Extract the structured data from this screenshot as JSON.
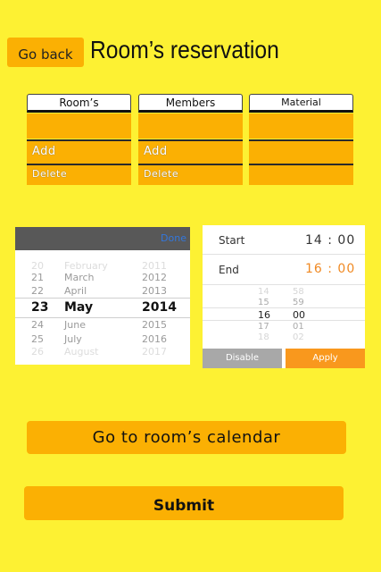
{
  "header": {
    "go_back_label": "Go back",
    "title": "Room’s reservation"
  },
  "columns": [
    {
      "header": "Room’s",
      "items": [
        "Add",
        "Delete"
      ]
    },
    {
      "header": "Members",
      "items": [
        "Add",
        "Delete"
      ]
    },
    {
      "header": "Material",
      "items": []
    }
  ],
  "date_picker": {
    "done_label": "Done",
    "rows": [
      {
        "day": "20",
        "month": "February",
        "year": "2011"
      },
      {
        "day": "21",
        "month": "March",
        "year": "2012"
      },
      {
        "day": "22",
        "month": "April",
        "year": "2013"
      },
      {
        "day": "23",
        "month": "May",
        "year": "2014"
      },
      {
        "day": "24",
        "month": "June",
        "year": "2015"
      },
      {
        "day": "25",
        "month": "July",
        "year": "2016"
      },
      {
        "day": "26",
        "month": "August",
        "year": "2017"
      }
    ]
  },
  "time_picker": {
    "start_label": "Start",
    "start_value": "14 : 00",
    "end_label": "End",
    "end_value": "16 : 00",
    "rows": [
      {
        "hour": "14",
        "minute": "58"
      },
      {
        "hour": "15",
        "minute": "59"
      },
      {
        "hour": "16",
        "minute": "00"
      },
      {
        "hour": "17",
        "minute": "01"
      },
      {
        "hour": "18",
        "minute": "02"
      }
    ],
    "disable_label": "Disable",
    "apply_label": "Apply"
  },
  "actions": {
    "calendar_label": "Go to room’s calendar",
    "submit_label": "Submit"
  },
  "colors": {
    "background": "#fdf133",
    "accent": "#fbb003",
    "apply": "#f9981d",
    "end_time": "#f08a24"
  }
}
